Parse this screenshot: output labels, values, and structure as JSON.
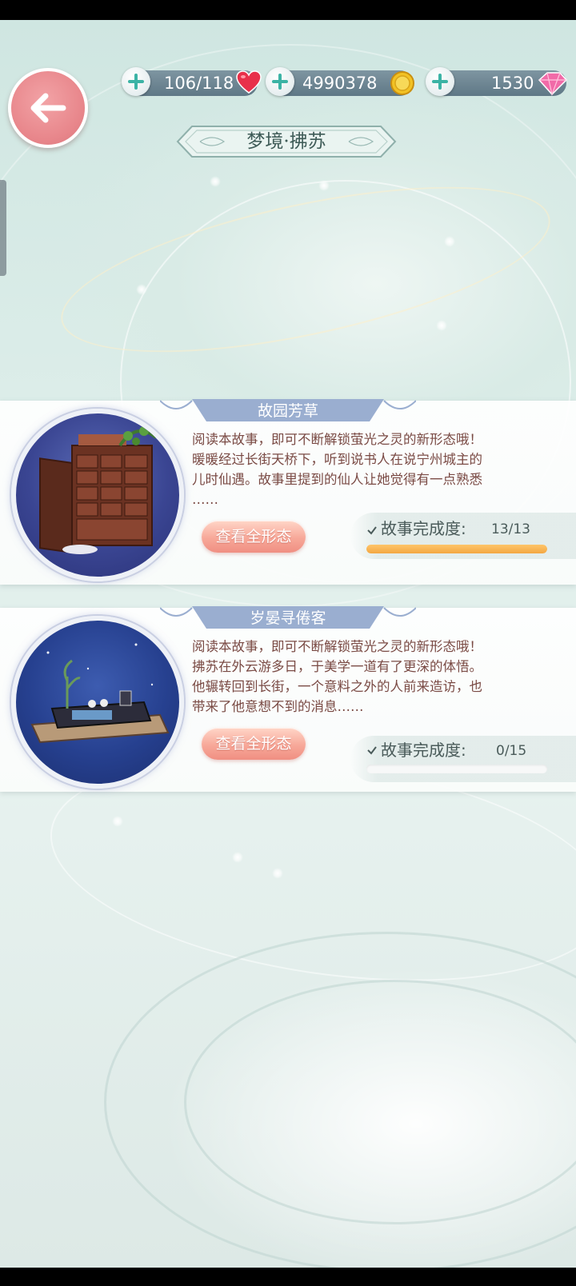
{
  "header": {
    "title": "梦境·拂苏",
    "resources": [
      {
        "name": "stamina",
        "value": "106/118",
        "icon": "heart-icon"
      },
      {
        "name": "gold",
        "value": "4990378",
        "icon": "coin-icon"
      },
      {
        "name": "gems",
        "value": "1530",
        "icon": "gem-icon"
      }
    ]
  },
  "stories": [
    {
      "title": "故园芳草",
      "desc_lines": [
        "阅读本故事，即可不断解锁萤光之灵的新形态哦！",
        "暖暖经过长街天桥下，听到说书人在说宁州城主的",
        "儿时仙遇。故事里提到的仙人让她觉得有一点熟悉",
        "……"
      ],
      "button_label": "查看全形态",
      "progress_label": "故事完成度:",
      "progress_value": "13/13",
      "progress_fraction": 1.0
    },
    {
      "title": "岁晏寻倦客",
      "desc_lines": [
        "阅读本故事，即可不断解锁萤光之灵的新形态哦！",
        "拂苏在外云游多日，于美学一道有了更深的体悟。",
        "他辗转回到长街，一个意料之外的人前来造访，也",
        "带来了他意想不到的消息……"
      ],
      "button_label": "查看全形态",
      "progress_label": "故事完成度:",
      "progress_value": "0/15",
      "progress_fraction": 0.0
    }
  ],
  "colors": {
    "accent_pink": "#e8868b",
    "button_salmon": "#f7a899",
    "progress_orange": "#f3a742",
    "desc_text": "#7a4a44"
  }
}
